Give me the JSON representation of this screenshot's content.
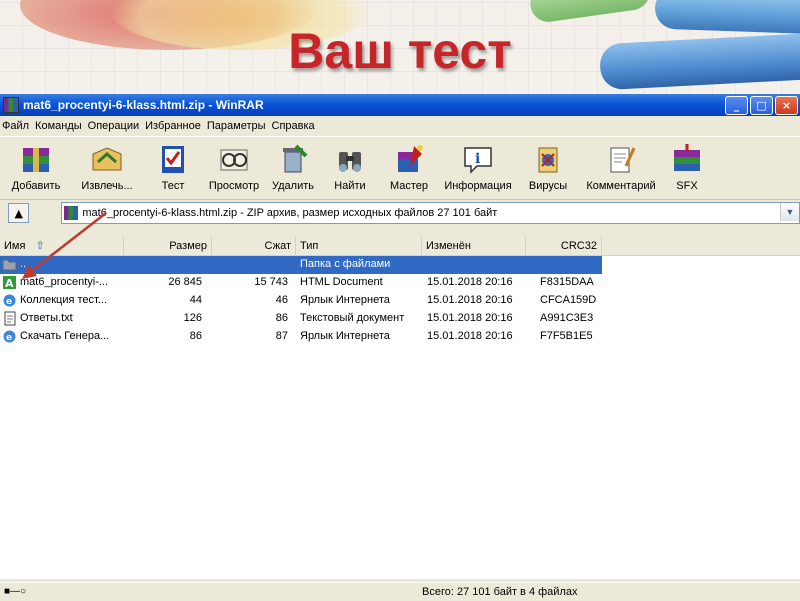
{
  "slide": {
    "title": "Ваш тест"
  },
  "window": {
    "title": "mat6_procentyi-6-klass.html.zip - WinRAR",
    "buttons": {
      "minimize": "_",
      "maximize": "□",
      "close": "×"
    }
  },
  "menu": [
    "Файл",
    "Команды",
    "Операции",
    "Избранное",
    "Параметры",
    "Справка"
  ],
  "toolbar": [
    {
      "label": "Добавить",
      "icon": "add-archive-icon"
    },
    {
      "label": "Извлечь...",
      "icon": "extract-icon"
    },
    {
      "label": "Тест",
      "icon": "test-icon"
    },
    {
      "label": "Просмотр",
      "icon": "view-icon"
    },
    {
      "label": "Удалить",
      "icon": "delete-icon"
    },
    {
      "label": "Найти",
      "icon": "find-icon"
    },
    {
      "label": "Мастер",
      "icon": "wizard-icon"
    },
    {
      "label": "Информация",
      "icon": "info-icon"
    },
    {
      "label": "Вирусы",
      "icon": "virus-icon"
    },
    {
      "label": "Комментарий",
      "icon": "comment-icon"
    },
    {
      "label": "SFX",
      "icon": "sfx-icon"
    }
  ],
  "address": {
    "text": "mat6_procentyi-6-klass.html.zip - ZIP архив, размер исходных файлов 27 101 байт"
  },
  "columns": {
    "name": "Имя",
    "size": "Размер",
    "packed": "Сжат",
    "type": "Тип",
    "modified": "Изменён",
    "crc": "CRC32"
  },
  "files": [
    {
      "name": "..",
      "size": "",
      "packed": "",
      "type": "Папка с файлами",
      "modified": "",
      "crc": "",
      "icon": "folder-up-icon",
      "selected": true
    },
    {
      "name": "mat6_procentyi-...",
      "size": "26 845",
      "packed": "15 743",
      "type": "HTML Document",
      "modified": "15.01.2018 20:16",
      "crc": "F8315DAA",
      "icon": "html-document-icon",
      "selected": false
    },
    {
      "name": "Коллекция тест...",
      "size": "44",
      "packed": "46",
      "type": "Ярлык Интернета",
      "modified": "15.01.2018 20:16",
      "crc": "CFCA159D",
      "icon": "internet-shortcut-icon",
      "selected": false
    },
    {
      "name": "Ответы.txt",
      "size": "126",
      "packed": "86",
      "type": "Текстовый документ",
      "modified": "15.01.2018 20:16",
      "crc": "A991C3E3",
      "icon": "text-document-icon",
      "selected": false
    },
    {
      "name": "Скачать Генера...",
      "size": "86",
      "packed": "87",
      "type": "Ярлык Интернета",
      "modified": "15.01.2018 20:16",
      "crc": "F7F5B1E5",
      "icon": "internet-shortcut-icon",
      "selected": false
    }
  ],
  "status": {
    "left_icon_text": "ключ",
    "summary": "Всего: 27 101 байт в 4 файлах"
  },
  "colors": {
    "title_red": "#c6262a",
    "selection": "#316ac5",
    "annotation_arrow": "#c0392b"
  }
}
